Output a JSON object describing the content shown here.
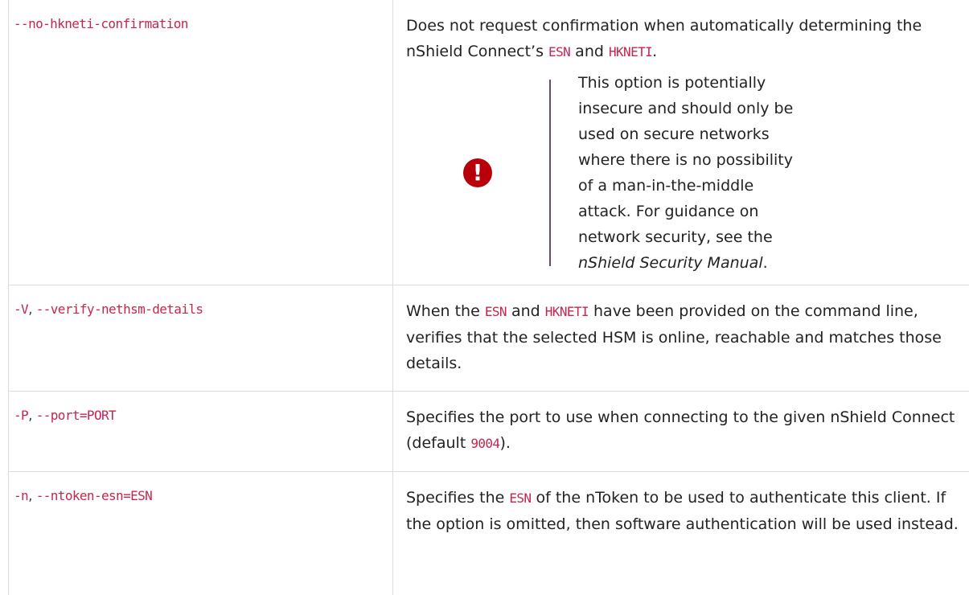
{
  "rows": [
    {
      "options": [
        {
          "code": "--no-hkneti-confirmation"
        }
      ],
      "desc": {
        "t1": "Does not request confirmation when automatically determining the nShield Connect’s ",
        "c1": "ESN",
        "t2": " and ",
        "c2": "HKNETI",
        "t3": "."
      },
      "warning": {
        "icon": "exclamation-icon",
        "text": "This option is potentially insecure and should only be used on secure networks where there is no possibility of a man-in-the-middle attack. For guidance on network security, see the ",
        "link": "nShield Security Manual",
        "end": "."
      }
    },
    {
      "options": [
        {
          "code": "-V"
        },
        {
          "sep": ", "
        },
        {
          "code": "--verify-nethsm-details"
        }
      ],
      "desc": {
        "t1": "When the ",
        "c1": "ESN",
        "t2": " and ",
        "c2": "HKNETI",
        "t3": " have been provided on the command line, verifies that the selected HSM is online, reachable and matches those details."
      }
    },
    {
      "options": [
        {
          "code": "-P"
        },
        {
          "sep": ", "
        },
        {
          "code": "--port=PORT"
        }
      ],
      "desc": {
        "t1": "Specifies the port to use when connecting to the given nShield Connect (default ",
        "c1": "9004",
        "t2": ")."
      }
    },
    {
      "options": [
        {
          "code": "-n"
        },
        {
          "sep": ", "
        },
        {
          "code": "--ntoken-esn=ESN"
        }
      ],
      "desc": {
        "t1": "Specifies the ",
        "c1": "ESN",
        "t2": " of the nToken to be used to authenticate this client. If the option is omitted, then software authentication will be used instead."
      }
    }
  ]
}
